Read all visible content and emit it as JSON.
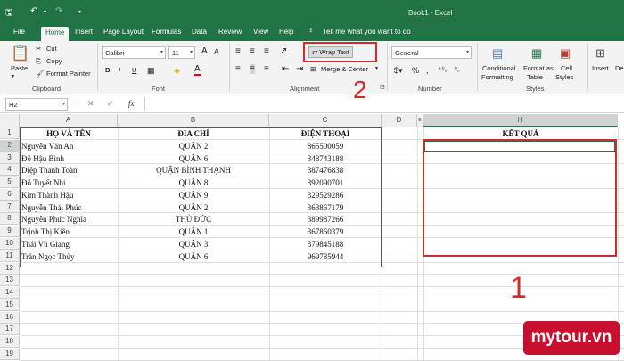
{
  "window": {
    "title": "Book1 - Excel"
  },
  "ribbon_tabs": [
    "File",
    "Home",
    "Insert",
    "Page Layout",
    "Formulas",
    "Data",
    "Review",
    "View",
    "Help"
  ],
  "tell_me": "Tell me what you want to do",
  "clipboard": {
    "paste": "Paste",
    "cut": "Cut",
    "copy": "Copy",
    "format_painter": "Format Painter",
    "group": "Clipboard"
  },
  "font": {
    "name": "Calibri",
    "size": "11",
    "bold": "B",
    "italic": "I",
    "underline": "U",
    "grow": "A",
    "shrink": "A",
    "color_a": "A",
    "group": "Font"
  },
  "alignment": {
    "wrap_text": "Wrap Text",
    "merge_center": "Merge & Center",
    "group": "Alignment"
  },
  "number": {
    "format": "General",
    "group": "Number",
    "percent": "%",
    "comma": ","
  },
  "styles": {
    "conditional": "Conditional",
    "conditional2": "Formatting",
    "format_as": "Format as",
    "format_as2": "Table",
    "cell": "Cell",
    "cell2": "Styles",
    "group": "Styles"
  },
  "cells": {
    "insert": "Insert",
    "delete": "De"
  },
  "formula_bar": {
    "name_box": "H2",
    "fx": "fx",
    "value": ""
  },
  "columns": [
    "A",
    "B",
    "C",
    "D",
    "E",
    "H"
  ],
  "rows": [
    "1",
    "2",
    "3",
    "4",
    "5",
    "6",
    "7",
    "8",
    "9",
    "10",
    "11",
    "12",
    "13",
    "14",
    "15",
    "16",
    "17",
    "18",
    "19"
  ],
  "table": {
    "headers": [
      "HỌ VÀ TÊN",
      "ĐỊA CHỈ",
      "ĐIỆN THOẠI",
      "KẾT QUẢ"
    ],
    "data": [
      [
        "Nguyễn Văn An",
        "QUẬN 2",
        "865500059"
      ],
      [
        "Đỗ Hậu Bình",
        "QUẬN 6",
        "348743188"
      ],
      [
        "Diệp Thanh Toàn",
        "QUẬN BÌNH THẠNH",
        "387476838"
      ],
      [
        "Đỗ Tuyết Nhi",
        "QUẬN 8",
        "392090701"
      ],
      [
        "Kim Thành Hậu",
        "QUẬN 9",
        "329529286"
      ],
      [
        "Nguyễn Thái Phúc",
        "QUẬN 2",
        "363867179"
      ],
      [
        "Nguyễn Phúc Nghĩa",
        "THỦ ĐỨC",
        "389987266"
      ],
      [
        "Trịnh Thị Kiên",
        "QUẬN 1",
        "367860379"
      ],
      [
        "Thái Vũ Giang",
        "QUẬN 3",
        "379845188"
      ],
      [
        "Trần Ngọc Thủy",
        "QUẬN 6",
        "969785944"
      ]
    ]
  },
  "annotations": {
    "step1": "1",
    "step2": "2",
    "accent": "#d42a2a"
  },
  "watermark": "mytour.vn",
  "colors": {
    "excel_green": "#217346"
  }
}
